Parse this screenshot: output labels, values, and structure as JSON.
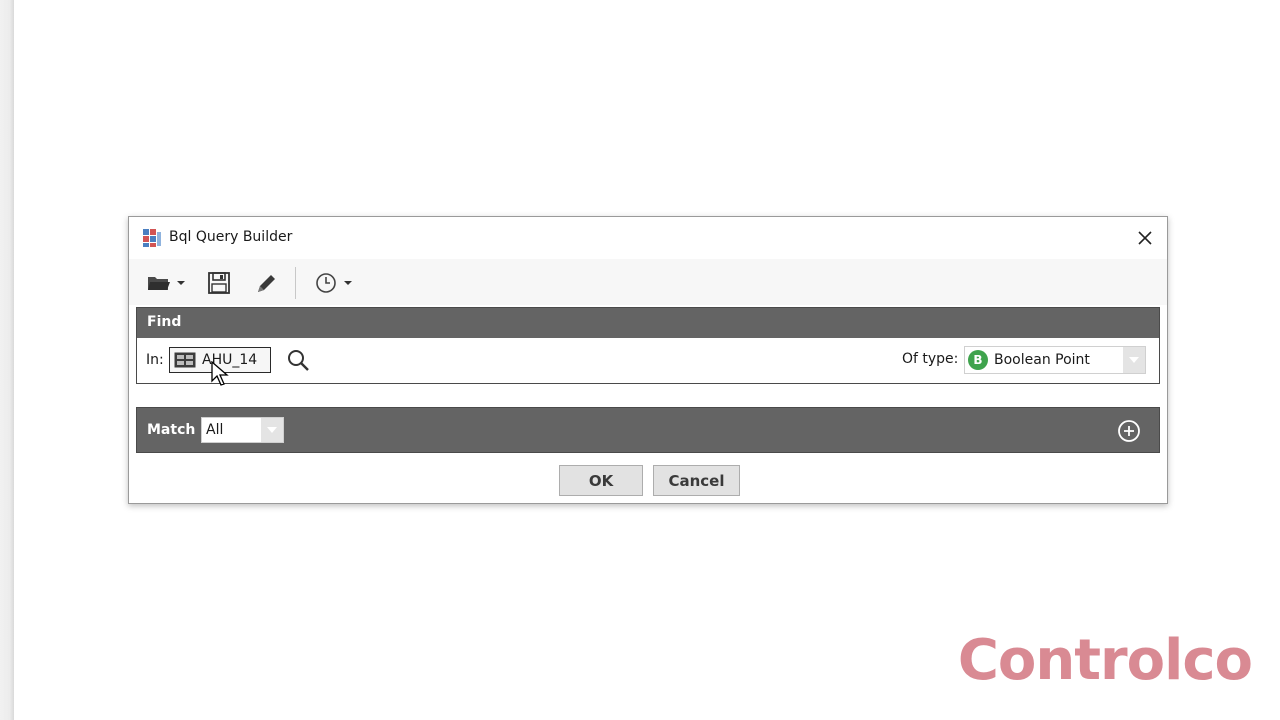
{
  "dialog": {
    "title": "Bql Query Builder"
  },
  "toolbar": {
    "items": [
      {
        "name": "open-folder",
        "icon": "folder-icon"
      },
      {
        "name": "save",
        "icon": "save-icon"
      },
      {
        "name": "edit",
        "icon": "pencil-icon"
      },
      {
        "name": "history",
        "icon": "clock-icon"
      }
    ]
  },
  "find": {
    "header_label": "Find",
    "in_label": "In:",
    "in_value": "AHU_14",
    "of_type_label": "Of type:",
    "type_badge": "B",
    "type_value": "Boolean Point"
  },
  "match": {
    "label": "Match",
    "value": "All"
  },
  "buttons": {
    "ok_label": "OK",
    "cancel_label": "Cancel"
  },
  "watermark": {
    "text": "Controlco"
  },
  "colors": {
    "section_header": "#646464",
    "type_badge": "#3fa34d",
    "watermark": "#d98a93"
  }
}
